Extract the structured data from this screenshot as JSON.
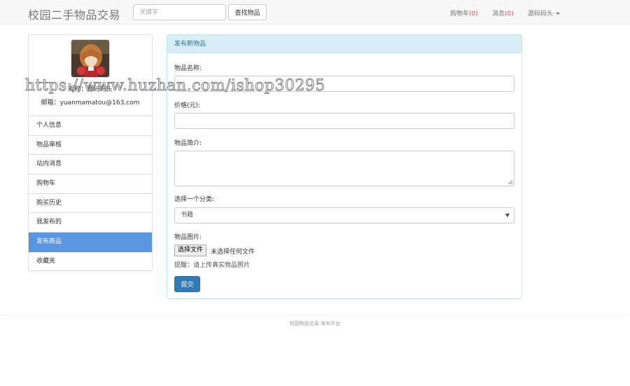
{
  "navbar": {
    "brand": "校园二手物品交易",
    "search_placeholder": "关键字",
    "search_button": "查找物品",
    "cart_label": "购物车",
    "cart_count": "(0)",
    "message_label": "消息",
    "message_count": "(0)",
    "user_label": "源码码头"
  },
  "sidebar": {
    "nickname": "昵称：源码码头",
    "email": "邮箱：yuanmamatou@163.com",
    "items": [
      {
        "label": "个人信息"
      },
      {
        "label": "物品审核"
      },
      {
        "label": "站内消息"
      },
      {
        "label": "购物车"
      },
      {
        "label": "购买历史"
      },
      {
        "label": "我发布的"
      },
      {
        "label": "发布商品",
        "active": true
      },
      {
        "label": "收藏夹"
      }
    ]
  },
  "form": {
    "heading": "发布新物品",
    "name_label": "物品名称:",
    "name_value": "",
    "price_label": "价格(元):",
    "price_value": "",
    "desc_label": "物品简介:",
    "desc_value": "",
    "category_label": "选择一个分类:",
    "category_selected": "书籍",
    "image_label": "物品图片:",
    "file_button": "选择文件",
    "file_status": "未选择任何文件",
    "hint": "提醒：请上传真实物品照片",
    "submit": "提交"
  },
  "footer": {
    "text": "校园物品交易-发布平台"
  },
  "watermark": "https://www.huzhan.com/ishop30295"
}
